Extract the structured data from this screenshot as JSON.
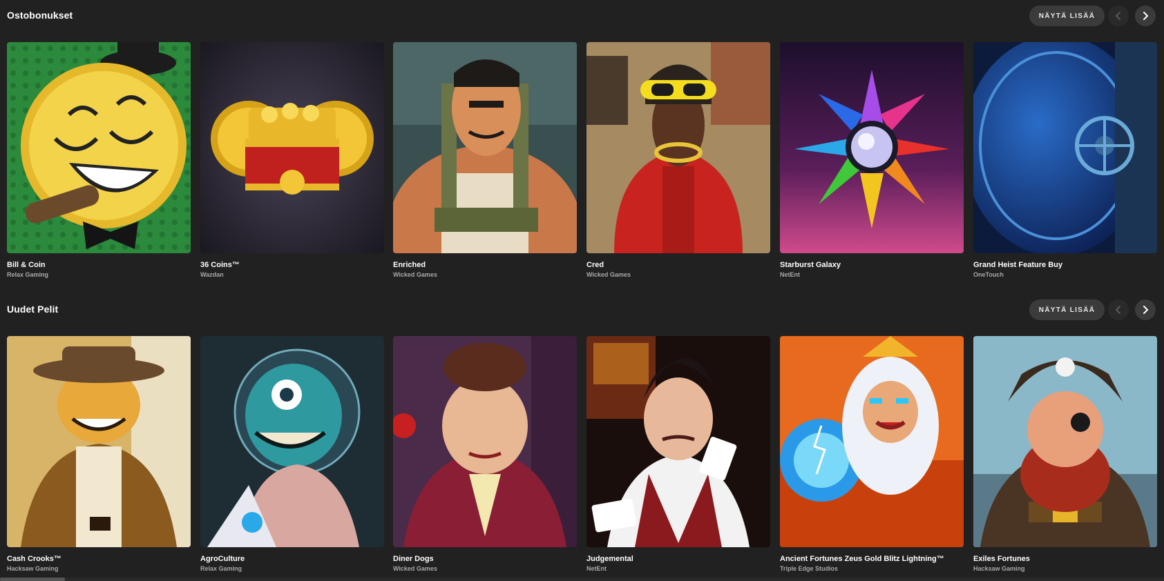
{
  "sections": [
    {
      "title": "Ostobonukset",
      "show_more": "NÄYTÄ LISÄÄ",
      "prev_icon": "chevron-left-icon",
      "next_icon": "chevron-right-icon",
      "games": [
        {
          "name": "Bill & Coin",
          "provider": "Relax Gaming"
        },
        {
          "name": "36 Coins™",
          "provider": "Wazdan"
        },
        {
          "name": "Enriched",
          "provider": "Wicked Games"
        },
        {
          "name": "Cred",
          "provider": "Wicked Games"
        },
        {
          "name": "Starburst Galaxy",
          "provider": "NetEnt"
        },
        {
          "name": "Grand Heist Feature Buy",
          "provider": "OneTouch"
        }
      ]
    },
    {
      "title": "Uudet Pelit",
      "show_more": "NÄYTÄ LISÄÄ",
      "prev_icon": "chevron-left-icon",
      "next_icon": "chevron-right-icon",
      "games": [
        {
          "name": "Cash Crooks™",
          "provider": "Hacksaw Gaming"
        },
        {
          "name": "AgroCulture",
          "provider": "Relax Gaming"
        },
        {
          "name": "Diner Dogs",
          "provider": "Wicked Games"
        },
        {
          "name": "Judgemental",
          "provider": "NetEnt"
        },
        {
          "name": "Ancient Fortunes Zeus Gold Blitz Lightning™",
          "provider": "Triple Edge Studios"
        },
        {
          "name": "Exiles Fortunes",
          "provider": "Hacksaw Gaming"
        }
      ]
    }
  ],
  "colors": {
    "background": "#212121",
    "button_bg": "#3b3b3b",
    "provider_text": "#a8a8a8"
  }
}
